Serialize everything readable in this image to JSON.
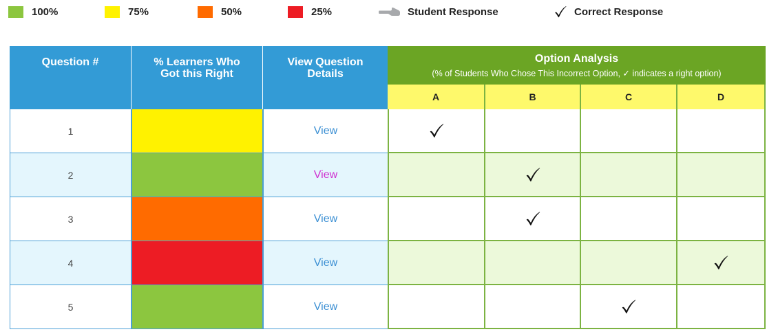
{
  "legend": [
    {
      "kind": "swatch",
      "color": "#8cc63f",
      "label": "100%"
    },
    {
      "kind": "swatch",
      "color": "#fff200",
      "label": "75%"
    },
    {
      "kind": "swatch",
      "color": "#ff6b00",
      "label": "50%"
    },
    {
      "kind": "swatch",
      "color": "#ed1c24",
      "label": "25%"
    },
    {
      "kind": "icon",
      "icon": "pointing-hand-icon",
      "label": "Student Response"
    },
    {
      "kind": "icon",
      "icon": "checkmark-icon",
      "label": "Correct Response"
    }
  ],
  "table": {
    "headers": {
      "question": "Question #",
      "percent": "% Learners Who Got this Right",
      "details": "View Question Details",
      "option_title": "Option Analysis",
      "option_subtitle": "(% of Students Who Chose This Incorrect Option, ✓ indicates a right option)"
    },
    "options": [
      "A",
      "B",
      "C",
      "D"
    ],
    "rows": [
      {
        "number": "1",
        "percent_color": "#fff200",
        "view_label": "View",
        "visited": false,
        "correct_option": "A"
      },
      {
        "number": "2",
        "percent_color": "#8cc63f",
        "view_label": "View",
        "visited": true,
        "correct_option": "B"
      },
      {
        "number": "3",
        "percent_color": "#ff6b00",
        "view_label": "View",
        "visited": false,
        "correct_option": "B"
      },
      {
        "number": "4",
        "percent_color": "#ed1c24",
        "view_label": "View",
        "visited": false,
        "correct_option": "D"
      },
      {
        "number": "5",
        "percent_color": "#8cc63f",
        "view_label": "View",
        "visited": false,
        "correct_option": "C"
      }
    ]
  },
  "colors": {
    "header_blue": "#339bd6",
    "header_green": "#6ba524",
    "option_header_yellow": "#fef96b",
    "row_alt_blue": "#e4f6fd",
    "row_alt_green": "#ecf9da",
    "link": "#3b8fd3",
    "link_visited": "#cf2fd0"
  }
}
